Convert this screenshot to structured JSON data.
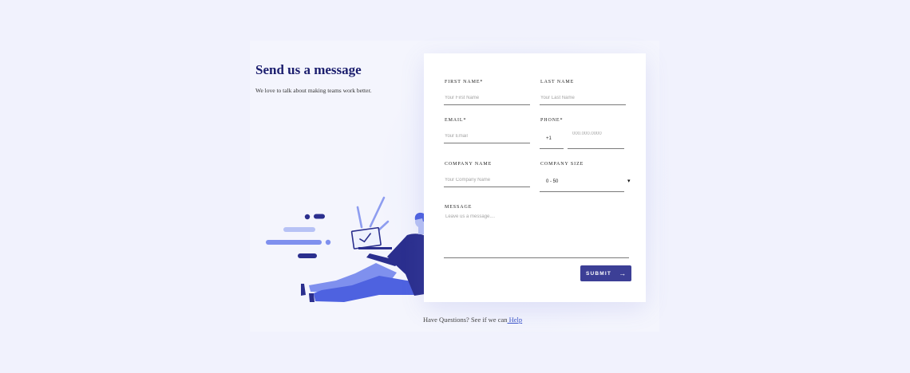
{
  "heading": {
    "title": "Send us a message",
    "subtitle": "We love to talk about making teams work better."
  },
  "form": {
    "first_name": {
      "label": "FIRST NAME*",
      "placeholder": "Your First Name"
    },
    "last_name": {
      "label": "LAST NAME",
      "placeholder": "Your Last Name"
    },
    "email": {
      "label": "EMAIL*",
      "placeholder": "Your Email"
    },
    "phone": {
      "label": "PHONE*",
      "country_code": "+1",
      "placeholder": "000.000.0000"
    },
    "company_name": {
      "label": "COMPANY NAME",
      "placeholder": "Your Company Name"
    },
    "company_size": {
      "label": "COMPANY SIZE",
      "selected": "0 - 50",
      "caret": "▾"
    },
    "message": {
      "label": "MESSAGE",
      "placeholder": "Leave us a message...."
    },
    "submit": {
      "label": "SUBMIT",
      "arrow": "→"
    }
  },
  "footer": {
    "text": "Have Questions? See if we can",
    "link": " Help"
  },
  "colors": {
    "background": "#f1f2fd",
    "heading": "#1b1e6e",
    "accent": "#3c3f96",
    "link": "#3b53c8"
  },
  "icons": {
    "illustration": "person-with-laptop-illustration",
    "submit_arrow": "arrow-right-icon",
    "select_caret": "caret-down-icon"
  }
}
